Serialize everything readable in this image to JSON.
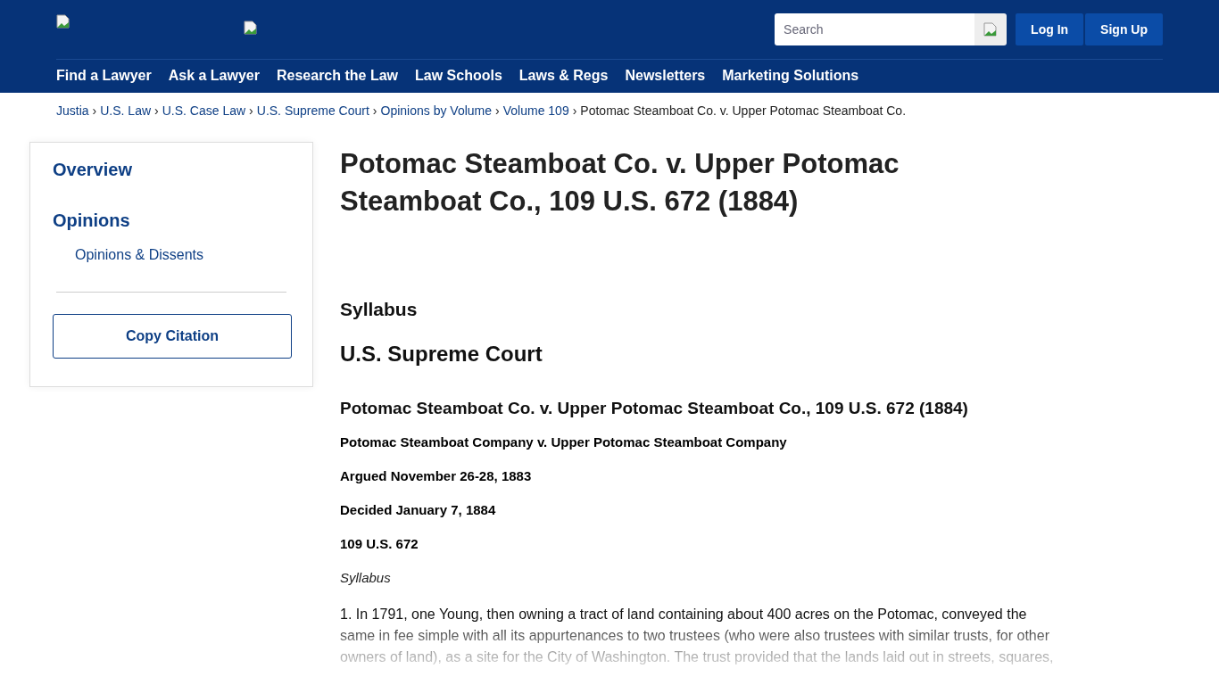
{
  "header": {
    "search": {
      "placeholder": "Search"
    },
    "buttons": [
      {
        "label": "Log In"
      },
      {
        "label": "Sign Up"
      }
    ],
    "nav": [
      "Find a Lawyer",
      "Ask a Lawyer",
      "Research the Law",
      "Law Schools",
      "Laws & Regs",
      "Newsletters",
      "Marketing Solutions"
    ]
  },
  "breadcrumbs": [
    {
      "kind": "link",
      "label": "Justia"
    },
    {
      "kind": "link",
      "separator": "›",
      "label": "U.S. Law"
    },
    {
      "kind": "link",
      "separator": "›",
      "label": "U.S. Case Law"
    },
    {
      "kind": "link",
      "separator": "›",
      "label": "U.S. Supreme Court"
    },
    {
      "kind": "link",
      "separator": "›",
      "label": "Opinions by Volume"
    },
    {
      "kind": "link",
      "separator": "›",
      "label": "Volume 109"
    },
    {
      "kind": "current",
      "separator": "›",
      "label": "Potomac Steamboat Co. v. Upper Potomac Steamboat Co."
    }
  ],
  "sidebar": {
    "sections": [
      {
        "label": "Overview"
      },
      {
        "label": "Opinions",
        "children": [
          "Opinions & Dissents"
        ]
      }
    ],
    "button": "Copy Citation"
  },
  "main": {
    "title": "Potomac Steamboat Co. v. Upper Potomac Steamboat Co., 109 U.S. 672 (1884)",
    "blocks": [
      {
        "kind": "h2",
        "text": "Syllabus"
      },
      {
        "kind": "h1",
        "text": "U.S. Supreme Court"
      },
      {
        "kind": "h3",
        "text": "Potomac Steamboat Co. v. Upper Potomac Steamboat Co., 109 U.S. 672 (1884)"
      },
      {
        "kind": "bold",
        "text": "Potomac Steamboat Company v. Upper Potomac Steamboat Company"
      },
      {
        "kind": "bold",
        "text": "Argued November 26-28, 1883"
      },
      {
        "kind": "bold",
        "text": "Decided January 7, 1884"
      },
      {
        "kind": "bold",
        "text": "109 U.S. 672"
      },
      {
        "kind": "italic",
        "text": "Syllabus"
      },
      {
        "kind": "fade",
        "text": "1. In 1791, one Young, then owning a tract of land containing about 400 acres on the Potomac, conveyed the same in fee simple with all its appurtenances to two trustees (who were also trustees with similar trusts, for other owners of land), as a site for the City of Washington. The trust provided that the lands laid out in streets, squares,"
      }
    ]
  }
}
